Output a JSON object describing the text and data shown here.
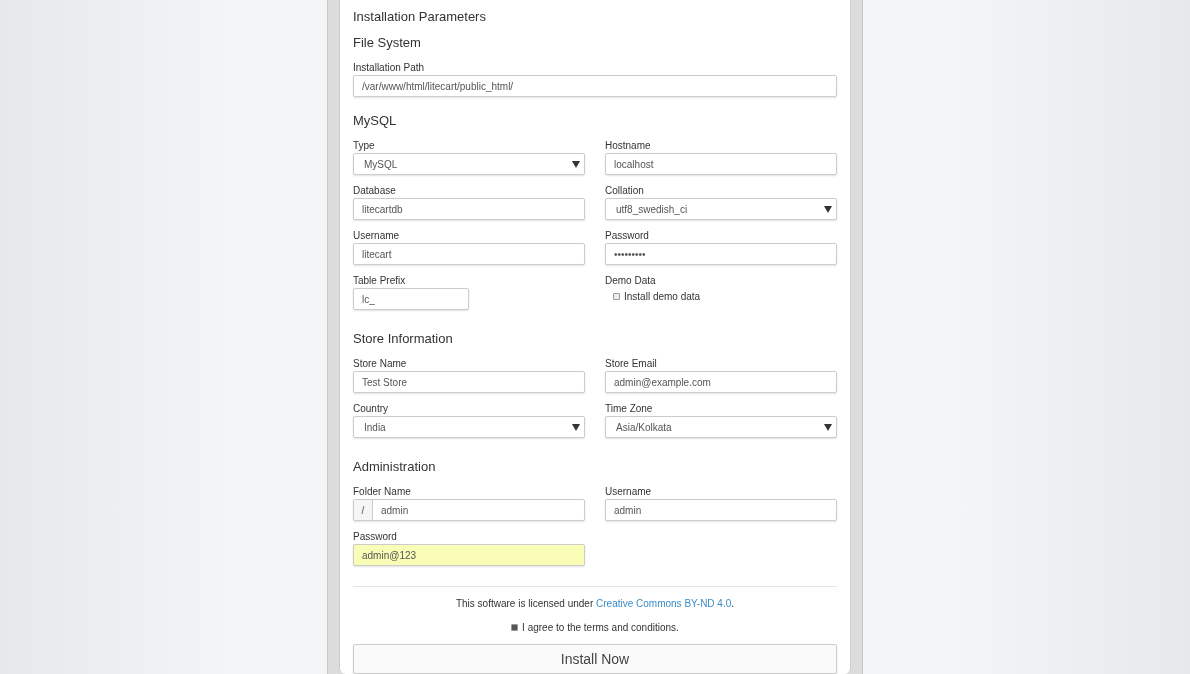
{
  "title": "Installation Parameters",
  "sections": [
    {
      "heading": "File System",
      "fields": [
        {
          "kind": "text",
          "label": "Installation Path",
          "value": "/var/www/html/litecart/public_html/"
        }
      ]
    },
    {
      "heading": "MySQL",
      "fields": [
        {
          "kind": "select",
          "label": "Type",
          "value": "MySQL"
        },
        {
          "kind": "text",
          "label": "Hostname",
          "value": "localhost"
        },
        {
          "kind": "text",
          "label": "Database",
          "value": "litecartdb"
        },
        {
          "kind": "select",
          "label": "Collation",
          "value": "utf8_swedish_ci"
        },
        {
          "kind": "text",
          "label": "Username",
          "value": "litecart"
        },
        {
          "kind": "password",
          "label": "Password",
          "value": "•••••••••"
        },
        {
          "kind": "short",
          "label": "Table Prefix",
          "value": "lc_"
        },
        {
          "kind": "checkbox",
          "label": "Demo Data",
          "option": "Install demo data",
          "checked": false
        }
      ]
    },
    {
      "heading": "Store Information",
      "fields": [
        {
          "kind": "text",
          "label": "Store Name",
          "value": "Test Store"
        },
        {
          "kind": "text",
          "label": "Store Email",
          "value": "admin@example.com"
        },
        {
          "kind": "select",
          "label": "Country",
          "value": "India"
        },
        {
          "kind": "select",
          "label": "Time Zone",
          "value": "Asia/Kolkata"
        }
      ]
    },
    {
      "heading": "Administration",
      "fields": [
        {
          "kind": "prefixed",
          "label": "Folder Name",
          "prefix": "/",
          "value": "admin"
        },
        {
          "kind": "text",
          "label": "Username",
          "value": "admin"
        },
        {
          "kind": "text",
          "label": "Password",
          "value": "admin@123",
          "highlighted": true
        }
      ]
    }
  ],
  "license": {
    "text": "This software is licensed under",
    "link": "Creative Commons BY-ND 4.0",
    "end": "."
  },
  "agree": {
    "label": "I agree to the terms and conditions.",
    "checked": true
  },
  "submit": "Install Now"
}
